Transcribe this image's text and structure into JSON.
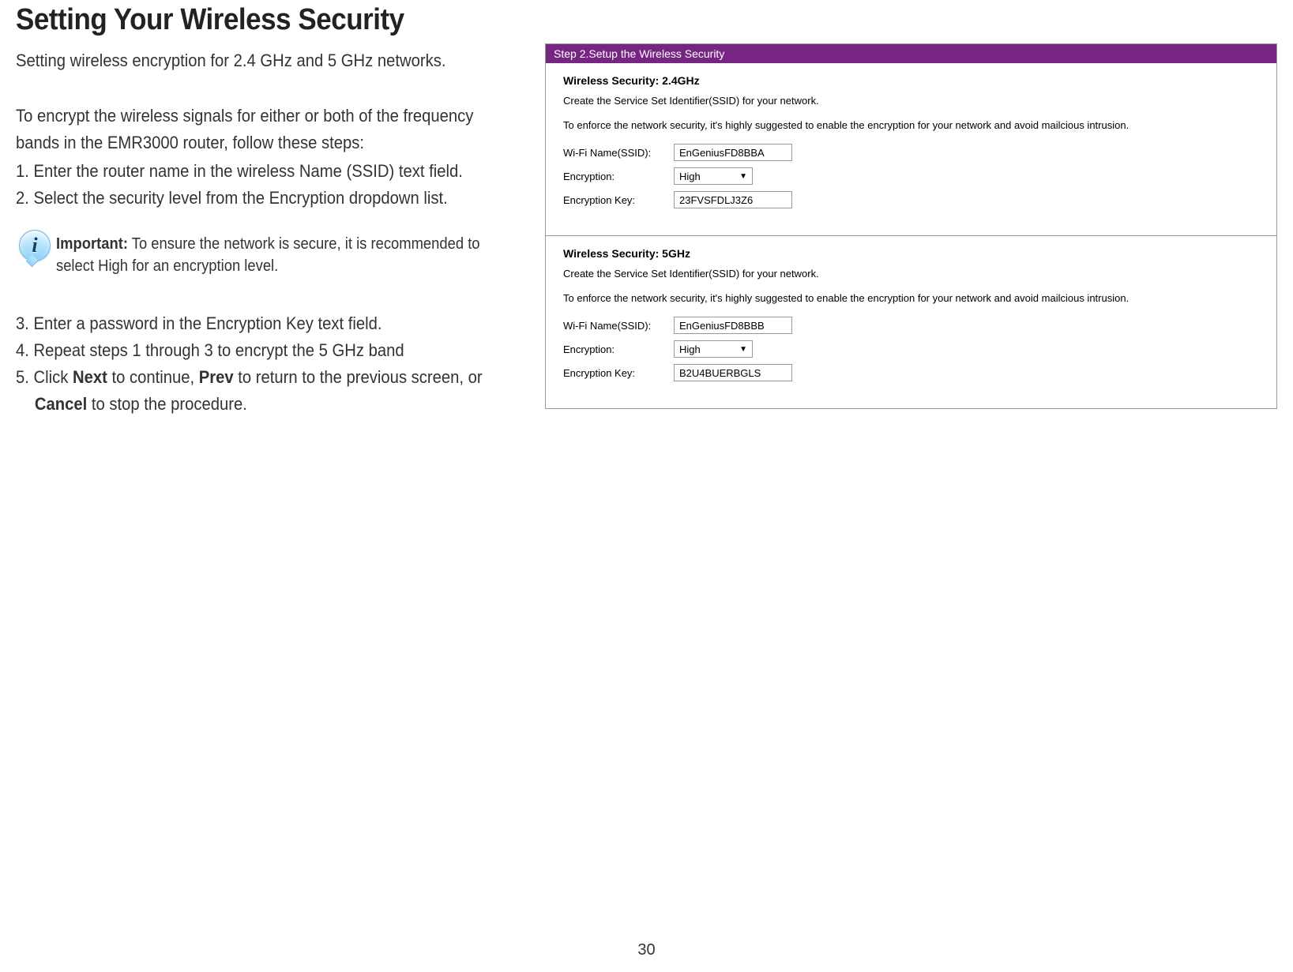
{
  "doc": {
    "title": "Setting Your Wireless Security",
    "intro": "Setting wireless encryption for 2.4 GHz and 5 GHz networks.",
    "para1": "To encrypt the wireless signals for either or both of the frequency bands in the EMR3000 router, follow these steps:",
    "step1": "1. Enter the router name in the wireless Name (SSID) text field.",
    "step2": "2. Select the security level from the Encryption dropdown list.",
    "step3": "3. Enter a password in the Encryption Key text field.",
    "step4": "4. Repeat steps 1 through 3 to encrypt the 5 GHz band",
    "step5_prefix": "5. Click ",
    "step5_next": "Next",
    "step5_mid1": " to continue, ",
    "step5_prev": "Prev",
    "step5_mid2": " to return to the previous screen, or",
    "step5_cancel": "Cancel",
    "step5_tail": " to stop the procedure.",
    "callout_bold": "Important:",
    "callout_text": " To ensure the network is secure, it is recommended to select High for an encryption level.",
    "page_number": "30"
  },
  "panel": {
    "header": "Step 2.Setup the Wireless Security",
    "sections": [
      {
        "title": "Wireless Security: 2.4GHz",
        "desc": "Create the Service Set Identifier(SSID) for your network.",
        "note": "To enforce the network security, it's highly suggested to enable the encryption for your network and avoid mailcious intrusion.",
        "ssid_label": "Wi-Fi Name(SSID):",
        "ssid_value": "EnGeniusFD8BBA",
        "enc_label": "Encryption:",
        "enc_value": "High",
        "key_label": "Encryption Key:",
        "key_value": "23FVSFDLJ3Z6"
      },
      {
        "title": "Wireless Security: 5GHz",
        "desc": "Create the Service Set Identifier(SSID) for your network.",
        "note": "To enforce the network security, it's highly suggested to enable the encryption for your network and avoid mailcious intrusion.",
        "ssid_label": "Wi-Fi Name(SSID):",
        "ssid_value": "EnGeniusFD8BBB",
        "enc_label": "Encryption:",
        "enc_value": "High",
        "key_label": "Encryption Key:",
        "key_value": "B2U4BUERBGLS"
      }
    ]
  }
}
